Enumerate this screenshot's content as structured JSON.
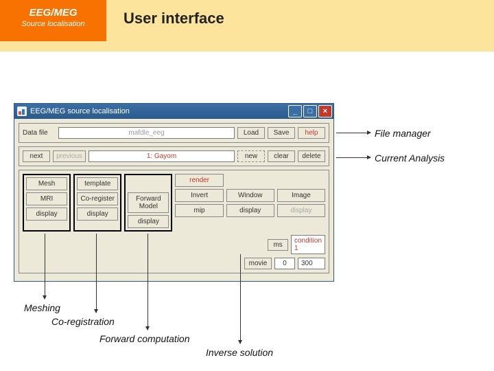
{
  "header": {
    "box_line1": "EEG/MEG",
    "box_line2": "Source localisation",
    "title": "User interface"
  },
  "window": {
    "title": "EEG/MEG source localisation",
    "file_group": {
      "label": "Data file",
      "value": "mafdle_eeg",
      "load": "Load",
      "save": "Save",
      "help": "help"
    },
    "analysis_group": {
      "next": "next",
      "previous": "previous",
      "value": "1: Gayom",
      "new": "new",
      "clear": "clear",
      "delete": "delete"
    },
    "pipeline": {
      "headers": [
        "Mesh",
        "",
        "",
        "",
        "",
        ""
      ],
      "row1": [
        "Mesh",
        "template",
        "",
        "render",
        "",
        ""
      ],
      "row2": [
        "MRI",
        "Co-register",
        "Forward Model",
        "Invert",
        "Window",
        "Image"
      ],
      "row3": [
        "display",
        "display",
        "display",
        "mip",
        "display",
        "display"
      ]
    },
    "footer": {
      "ms": "ms",
      "condition": "condition 1",
      "movie": "movie",
      "zero": "0",
      "val": "300"
    }
  },
  "annotations": {
    "file_manager": "File manager",
    "current_analysis": "Current Analysis",
    "meshing": "Meshing",
    "coreg": "Co-registration",
    "forward": "Forward computation",
    "inverse": "Inverse solution"
  }
}
